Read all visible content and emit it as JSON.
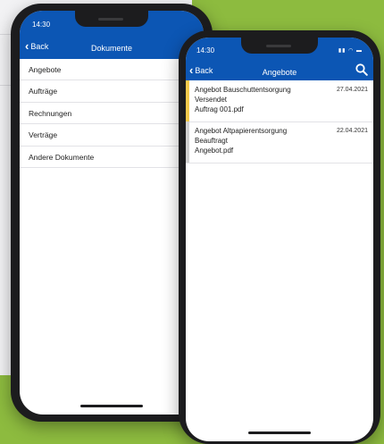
{
  "left_phone": {
    "status_time": "14:30",
    "nav": {
      "back_label": "Back",
      "title": "Dokumente"
    },
    "menu_items": [
      "Angebote",
      "Aufträge",
      "Rechnungen",
      "Verträge",
      "Andere Dokumente"
    ]
  },
  "right_phone": {
    "status_time": "14:30",
    "nav": {
      "back_label": "Back",
      "title": "Angebote"
    },
    "documents": [
      {
        "title": "Angebot Bauschuttentsorgung",
        "status": "Versendet",
        "file": "Auftrag 001.pdf",
        "date": "27.04.2021",
        "accent": "#f2c94c"
      },
      {
        "title": "Angebot Altpapierentsorgung",
        "status": "Beauftragt",
        "file": "Angebot.pdf",
        "date": "22.04.2021",
        "accent": "#d0d0d0"
      }
    ]
  },
  "colors": {
    "nav_blue": "#0c56b4",
    "background_green": "#8dbb3f"
  }
}
